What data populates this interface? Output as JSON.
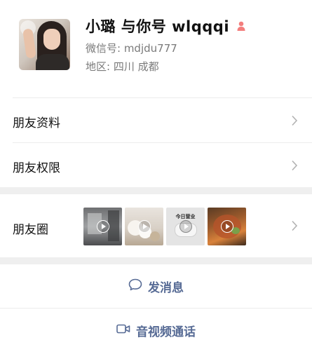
{
  "profile": {
    "name": "小璐 与你号 wlqqqi",
    "wechat_id": "微信号: mdjdu777",
    "region": "地区: 四川 成都",
    "gender": "female"
  },
  "menu": {
    "friend_info": "朋友资料",
    "friend_permissions": "朋友权限",
    "moments": "朋友圈"
  },
  "moments_thumbnails": [
    {
      "type": "video",
      "desc": "bathroom"
    },
    {
      "type": "video",
      "desc": "flowers"
    },
    {
      "type": "video",
      "desc": "今日营业",
      "caption": "今日营业"
    },
    {
      "type": "video",
      "desc": "food"
    }
  ],
  "actions": {
    "message": "发消息",
    "video_call": "音视频通话"
  },
  "colors": {
    "accent": "#576b95",
    "gender_female": "#f37e7d",
    "separator": "#efefef"
  }
}
